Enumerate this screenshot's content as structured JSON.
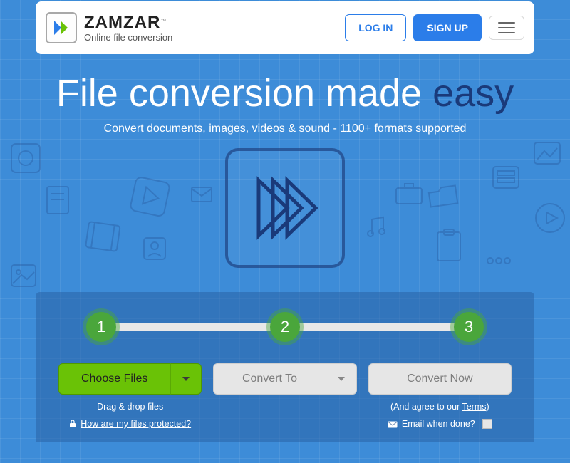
{
  "brand": {
    "name": "ZAMZAR",
    "tm": "™",
    "tagline": "Online file conversion"
  },
  "header": {
    "login": "LOG IN",
    "signup": "SIGN UP"
  },
  "hero": {
    "title_a": "File conversion made ",
    "title_b": "easy",
    "sub": "Convert documents, images, videos & sound - 1100+ formats supported"
  },
  "steps": {
    "s1": "1",
    "s2": "2",
    "s3": "3"
  },
  "panel": {
    "choose": "Choose Files",
    "dragdrop": "Drag & drop files",
    "protected": "How are my files protected?",
    "convertto": "Convert To",
    "convertnow": "Convert Now",
    "agree_a": "(And agree to our ",
    "agree_link": "Terms",
    "agree_b": ")",
    "emailwhen": "Email when done?"
  }
}
